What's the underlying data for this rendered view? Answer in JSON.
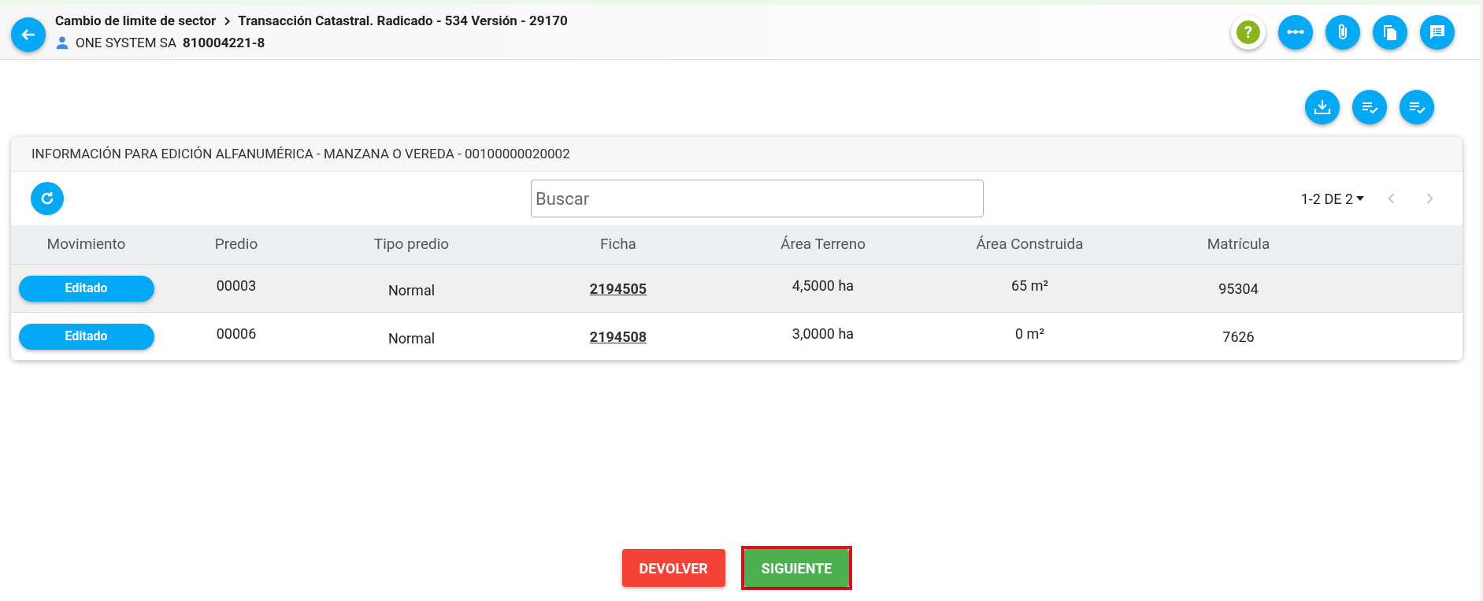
{
  "header": {
    "breadcrumb": [
      "Cambio de limite de sector",
      "Transacción Catastral. Radicado - 534 Versión - 29170"
    ],
    "owner": "ONE SYSTEM SA",
    "owner_id": "810004221-8"
  },
  "header_actions": [
    {
      "kind": "help",
      "glyph": "?"
    },
    {
      "kind": "flow"
    },
    {
      "kind": "attach"
    },
    {
      "kind": "copy"
    },
    {
      "kind": "notes"
    }
  ],
  "toolbar_actions": [
    {
      "kind": "download"
    },
    {
      "kind": "checklist"
    },
    {
      "kind": "checklist"
    }
  ],
  "card": {
    "title": "INFORMACIÓN PARA EDICIÓN ALFANUMÉRICA - MANZANA O VEREDA - 00100000020002",
    "search": {
      "placeholder": "Buscar"
    },
    "pagination": "1-2 DE 2",
    "table": {
      "columns": [
        "Movimiento",
        "Predio",
        "Tipo predio",
        "Ficha",
        "Área Terreno",
        "Área Construida",
        "Matrícula"
      ],
      "rows": [
        {
          "hovered": true,
          "movimiento": "Editado",
          "predio": "00003",
          "tipo": "Normal",
          "ficha": "2194505",
          "area_terreno": "4,5000 ha",
          "area_construida": "65 m²",
          "matricula": "95304"
        },
        {
          "hovered": false,
          "movimiento": "Editado",
          "predio": "00006",
          "tipo": "Normal",
          "ficha": "2194508",
          "area_terreno": "3,0000 ha",
          "area_construida": "0 m²",
          "matricula": "7626"
        }
      ]
    }
  },
  "footer_buttons": [
    {
      "label": "DEVOLVER",
      "kind": "danger",
      "highlighted": false
    },
    {
      "label": "SIGUIENTE",
      "kind": "success",
      "highlighted": true
    }
  ]
}
